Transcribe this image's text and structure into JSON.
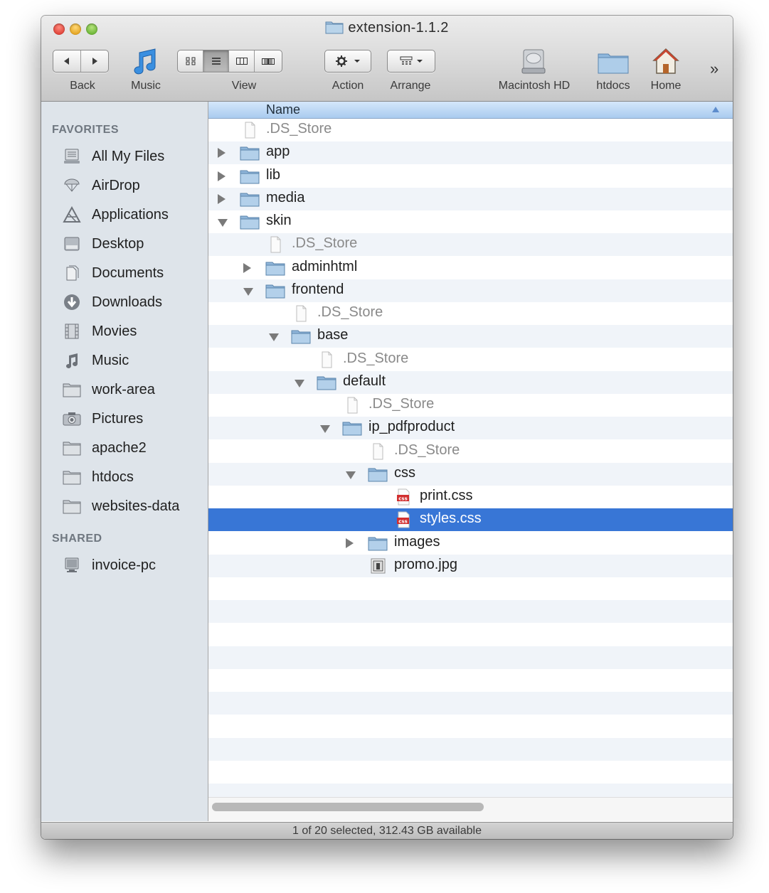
{
  "window": {
    "title": "extension-1.1.2"
  },
  "toolbar": {
    "back_label": "Back",
    "music_label": "Music",
    "view_label": "View",
    "action_label": "Action",
    "arrange_label": "Arrange",
    "devices": [
      {
        "label": "Macintosh HD",
        "icon": "hard-drive-icon"
      },
      {
        "label": "htdocs",
        "icon": "folder-icon"
      },
      {
        "label": "Home",
        "icon": "home-icon"
      }
    ],
    "overflow": "»"
  },
  "sidebar": {
    "favorites_header": "FAVORITES",
    "shared_header": "SHARED",
    "favorites": [
      {
        "label": "All My Files",
        "icon": "all-files-icon"
      },
      {
        "label": "AirDrop",
        "icon": "airdrop-icon"
      },
      {
        "label": "Applications",
        "icon": "applications-icon"
      },
      {
        "label": "Desktop",
        "icon": "desktop-icon"
      },
      {
        "label": "Documents",
        "icon": "documents-icon"
      },
      {
        "label": "Downloads",
        "icon": "downloads-icon"
      },
      {
        "label": "Movies",
        "icon": "movies-icon"
      },
      {
        "label": "Music",
        "icon": "music-icon"
      },
      {
        "label": "work-area",
        "icon": "folder-icon"
      },
      {
        "label": "Pictures",
        "icon": "camera-icon"
      },
      {
        "label": "apache2",
        "icon": "folder-icon"
      },
      {
        "label": "htdocs",
        "icon": "folder-icon"
      },
      {
        "label": "websites-data",
        "icon": "folder-icon"
      }
    ],
    "shared": [
      {
        "label": "invoice-pc",
        "icon": "computer-icon"
      }
    ]
  },
  "list": {
    "column_name": "Name",
    "rows": [
      {
        "name": ".DS_Store",
        "type": "file",
        "depth": 0
      },
      {
        "name": "app",
        "type": "folder",
        "depth": 0,
        "expanded": false
      },
      {
        "name": "lib",
        "type": "folder",
        "depth": 0,
        "expanded": false
      },
      {
        "name": "media",
        "type": "folder",
        "depth": 0,
        "expanded": false
      },
      {
        "name": "skin",
        "type": "folder",
        "depth": 0,
        "expanded": true
      },
      {
        "name": ".DS_Store",
        "type": "file",
        "depth": 1
      },
      {
        "name": "adminhtml",
        "type": "folder",
        "depth": 1,
        "expanded": false
      },
      {
        "name": "frontend",
        "type": "folder",
        "depth": 1,
        "expanded": true
      },
      {
        "name": ".DS_Store",
        "type": "file",
        "depth": 2
      },
      {
        "name": "base",
        "type": "folder",
        "depth": 2,
        "expanded": true
      },
      {
        "name": ".DS_Store",
        "type": "file",
        "depth": 3
      },
      {
        "name": "default",
        "type": "folder",
        "depth": 3,
        "expanded": true
      },
      {
        "name": ".DS_Store",
        "type": "file",
        "depth": 4
      },
      {
        "name": "ip_pdfproduct",
        "type": "folder",
        "depth": 4,
        "expanded": true
      },
      {
        "name": ".DS_Store",
        "type": "file",
        "depth": 5
      },
      {
        "name": "css",
        "type": "folder",
        "depth": 5,
        "expanded": true
      },
      {
        "name": "print.css",
        "type": "css",
        "depth": 6
      },
      {
        "name": "styles.css",
        "type": "css",
        "depth": 6,
        "selected": true
      },
      {
        "name": "images",
        "type": "folder",
        "depth": 5,
        "expanded": false
      },
      {
        "name": "promo.jpg",
        "type": "image",
        "depth": 5
      }
    ]
  },
  "status": {
    "text": "1 of 20 selected, 312.43 GB available"
  },
  "colors": {
    "selection": "#3876d6",
    "sidebar": "#dee4ea",
    "stripe": "#f0f4f9"
  }
}
